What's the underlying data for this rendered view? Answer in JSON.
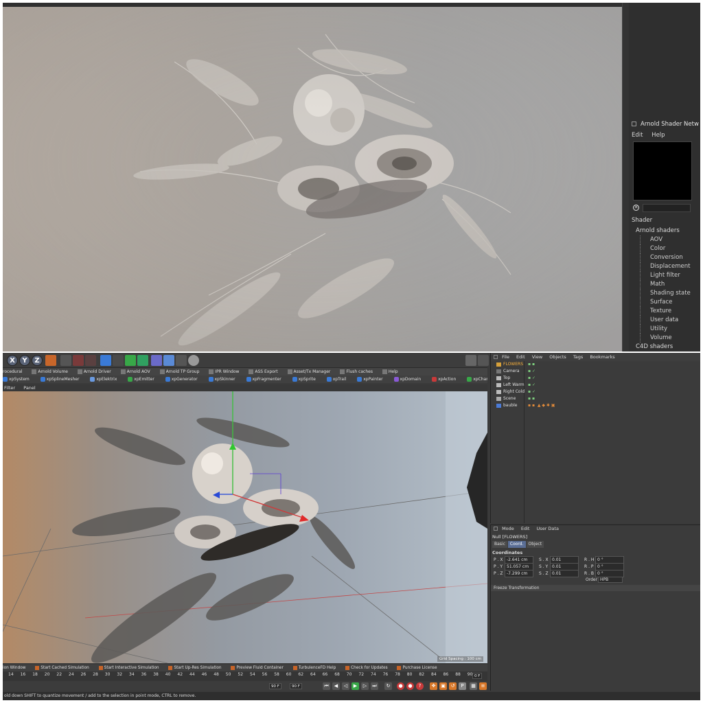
{
  "shader_panel": {
    "title": "Arnold Shader Netw",
    "menu": [
      "Edit",
      "Help"
    ],
    "section_label": "Shader",
    "tree_root": "Arnold shaders",
    "tree_children": [
      "AOV",
      "Color",
      "Conversion",
      "Displacement",
      "Light filter",
      "Math",
      "Shading state",
      "Surface",
      "Texture",
      "User data",
      "Utility",
      "Volume"
    ],
    "tree_sibling": "C4D shaders"
  },
  "toolbar": {
    "axis_x": "X",
    "axis_y": "Y",
    "axis_z": "Z"
  },
  "plugin_bar": [
    "rocedural",
    "Arnold Volume",
    "Arnold Driver",
    "Arnold AOV",
    "Arnold TP Group",
    "IPR Window",
    "ASS Export",
    "Asset/Tx Manager",
    "Flush caches",
    "Help"
  ],
  "xp_bar": [
    "xpSystem",
    "xpSplineMesher",
    "xpElektrix",
    "xpEmitter",
    "xpGenerator",
    "xpSkinner",
    "xpFragmenter",
    "xpSprite",
    "xpTrail",
    "xpPainter",
    "xpDomain",
    "xpAction",
    "xpChangeGroup"
  ],
  "viewport_menu": [
    "Filter",
    "Panel"
  ],
  "grid_spacing": "Grid Spacing : 100 cm",
  "sim_bar": [
    "ion Window",
    "Start Cached Simulation",
    "Start Interactive Simulation",
    "Start Up-Res Simulation",
    "Preview Fluid Container",
    "TurbulenceFD Help",
    "Check for Updates",
    "Purchase License"
  ],
  "timeline": {
    "ticks": [
      "14",
      "16",
      "18",
      "20",
      "22",
      "24",
      "26",
      "28",
      "30",
      "32",
      "34",
      "36",
      "38",
      "40",
      "42",
      "44",
      "46",
      "48",
      "50",
      "52",
      "54",
      "56",
      "58",
      "60",
      "62",
      "64",
      "66",
      "68",
      "70",
      "72",
      "74",
      "76",
      "78",
      "80",
      "82",
      "84",
      "86",
      "88",
      "90"
    ],
    "current_frame": "0 F",
    "end_frame_a": "90 F",
    "end_frame_b": "90 F"
  },
  "status": "old down SHIFT to quantize movement / add to the selection in point mode, CTRL to remove.",
  "object_manager": {
    "menu": [
      "File",
      "Edit",
      "View",
      "Objects",
      "Tags",
      "Bookmarks"
    ],
    "objects": [
      {
        "name": "FLOWERS",
        "selected": true
      },
      {
        "name": "Camera",
        "selected": false
      },
      {
        "name": "Top",
        "selected": false
      },
      {
        "name": "Left Warm",
        "selected": false
      },
      {
        "name": "Right Cold",
        "selected": false
      },
      {
        "name": "Scene",
        "selected": false
      },
      {
        "name": "bauble",
        "selected": false
      }
    ]
  },
  "attribute_manager": {
    "menu": [
      "Mode",
      "Edit",
      "User Data"
    ],
    "object_label": "Null [FLOWERS]",
    "tabs": [
      "Basic",
      "Coord.",
      "Object"
    ],
    "active_tab": "Coord.",
    "section": "Coordinates",
    "rows": [
      {
        "p_label": "P . X",
        "p_val": "-2.641 cm",
        "s_label": "S . X",
        "s_val": "0.01",
        "r_label": "R . H",
        "r_val": "0 °"
      },
      {
        "p_label": "P . Y",
        "p_val": "51.057 cm",
        "s_label": "S . Y",
        "s_val": "0.01",
        "r_label": "R . P",
        "r_val": "0 °"
      },
      {
        "p_label": "P . Z",
        "p_val": "-7.299 cm",
        "s_label": "S . Z",
        "s_val": "0.01",
        "r_label": "R . B",
        "r_val": "0 °"
      }
    ],
    "order_label": "Order",
    "order_value": "HPB",
    "freeze": "Freeze Transformation"
  }
}
